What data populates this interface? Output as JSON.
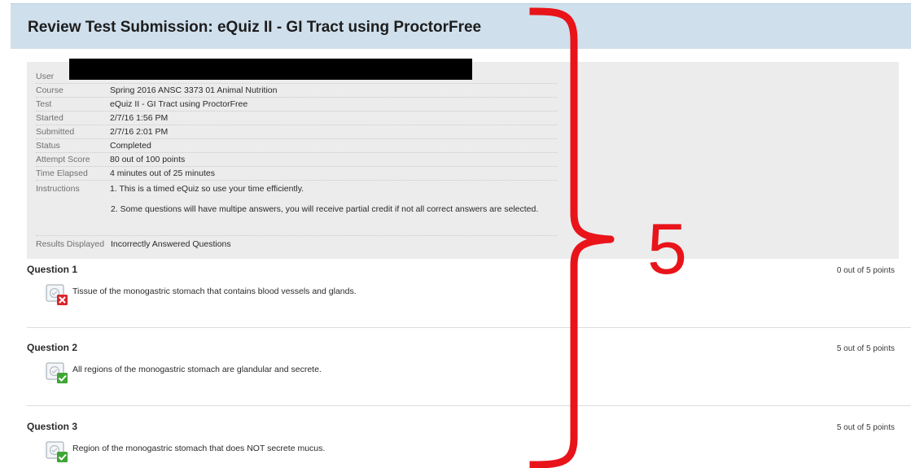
{
  "header": {
    "title": "Review Test Submission: eQuiz II - GI Tract using ProctorFree"
  },
  "details": {
    "rows": [
      {
        "label": "User",
        "value": ""
      },
      {
        "label": "Course",
        "value": "Spring 2016 ANSC 3373 01 Animal Nutrition"
      },
      {
        "label": "Test",
        "value": "eQuiz II - GI Tract using ProctorFree"
      },
      {
        "label": "Started",
        "value": "2/7/16 1:56 PM"
      },
      {
        "label": "Submitted",
        "value": "2/7/16 2:01 PM"
      },
      {
        "label": "Status",
        "value": "Completed"
      },
      {
        "label": "Attempt Score",
        "value": "80 out of 100 points"
      },
      {
        "label": "Time Elapsed",
        "value": "4 minutes out of 25 minutes"
      }
    ],
    "instructions": {
      "label": "Instructions",
      "line1": "1. This is a timed eQuiz so use your time efficiently.",
      "line2": "2. Some questions will have multipe answers, you will receive partial credit if not all correct answers are selected."
    },
    "results": {
      "label": "Results Displayed",
      "value": "Incorrectly Answered Questions"
    }
  },
  "questions": [
    {
      "title": "Question 1",
      "points": "0 out of 5 points",
      "text": "Tissue of the monogastric stomach that contains blood vessels and glands.",
      "status": "incorrect"
    },
    {
      "title": "Question 2",
      "points": "5 out of 5 points",
      "text": "All regions of the monogastric stomach are glandular and secrete.",
      "status": "correct"
    },
    {
      "title": "Question 3",
      "points": "5 out of 5 points",
      "text": "Region of the monogastric stomach that does NOT secrete mucus.",
      "status": "correct"
    }
  ],
  "annotation": {
    "number": "5",
    "color": "#e8141a"
  },
  "colors": {
    "header_bg": "#cfdfec",
    "details_bg": "#ececec",
    "correct": "#3fa535",
    "incorrect": "#d9262b"
  }
}
